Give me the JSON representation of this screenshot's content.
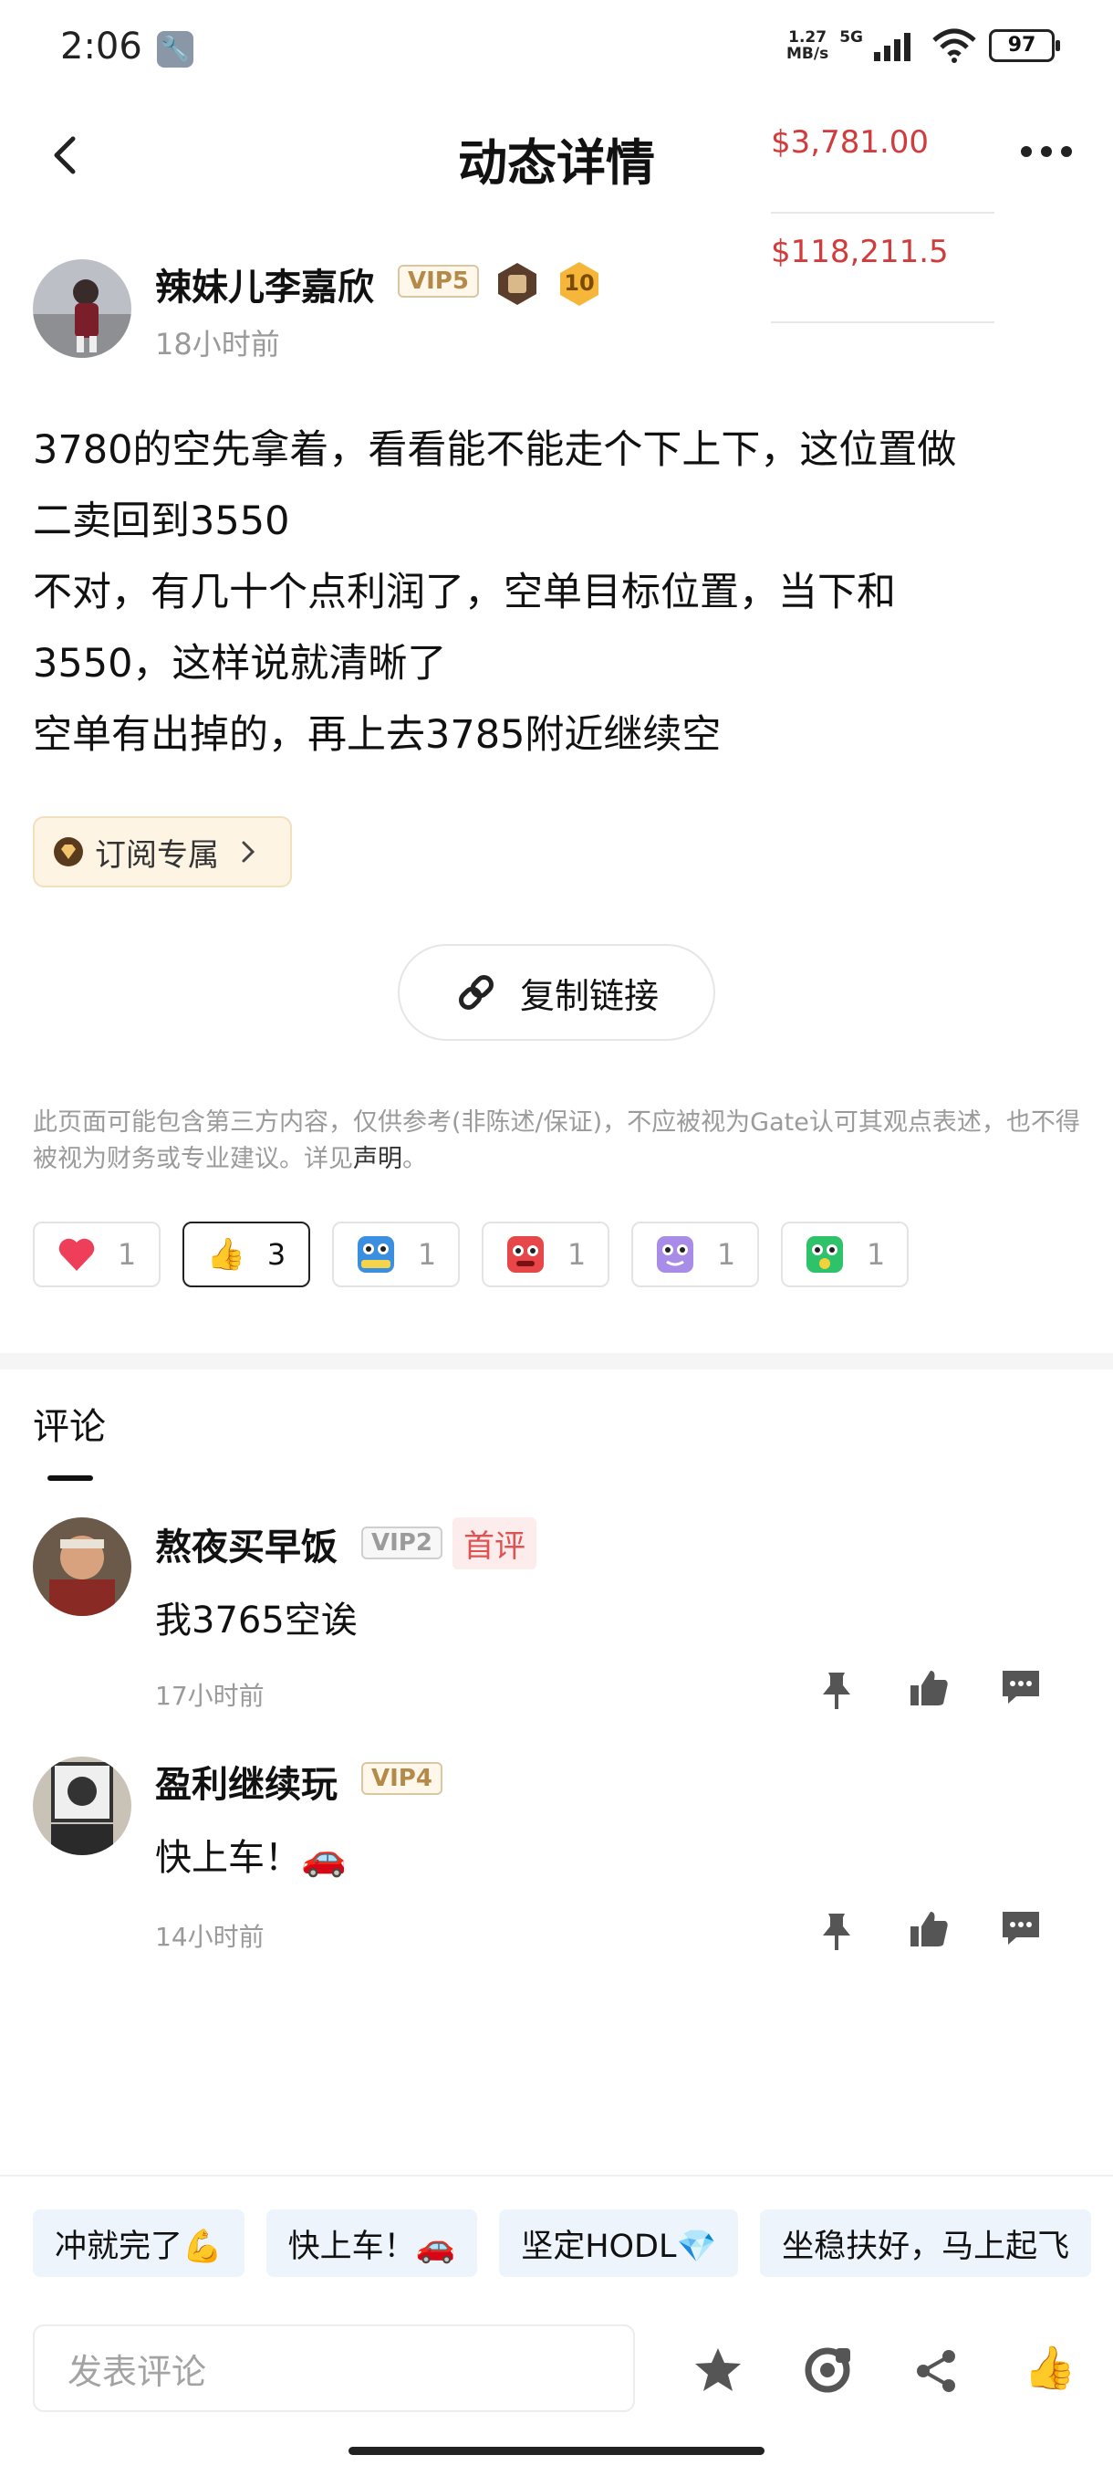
{
  "status_bar": {
    "time": "2:06",
    "net_speed_value": "1.27",
    "net_speed_unit": "MB/s",
    "network": "5G",
    "battery": "97"
  },
  "header": {
    "title": "动态详情",
    "back_icon": "chevron-left-icon",
    "more_icon": "more-horizontal-icon"
  },
  "tickers": [
    "$3,781.00",
    "$118,211.5"
  ],
  "author": {
    "name": "辣妹儿李嘉欣",
    "vip": "VIP5",
    "level": "10",
    "time": "18小时前"
  },
  "post": {
    "lines": [
      "3780的空先拿着，看看能不能走个下上下，这位置做",
      "二卖回到3550",
      "不对，有几十个点利润了，空单目标位置，当下和",
      "3550，这样说就清晰了",
      "空单有出掉的，再上去3785附近继续空"
    ]
  },
  "subscription_chip": {
    "label": "订阅专属"
  },
  "copy_link": {
    "label": "复制链接"
  },
  "disclaimer": {
    "text": "此页面可能包含第三方内容，仅供参考(非陈述/保证)，不应被视为Gate认可其观点表述，也不得被视为财务或专业建议。详见",
    "link": "声明",
    "end": "。"
  },
  "reactions": [
    {
      "icon": "heart-icon",
      "count": "1"
    },
    {
      "icon": "thumbs-up-icon",
      "count": "3"
    },
    {
      "icon": "hodl-icon",
      "count": "1"
    },
    {
      "icon": "angry-face-icon",
      "count": "1"
    },
    {
      "icon": "purple-face-icon",
      "count": "1"
    },
    {
      "icon": "green-face-icon",
      "count": "1"
    }
  ],
  "comments_section": {
    "title": "评论"
  },
  "comments": [
    {
      "name": "熬夜买早饭",
      "vip": "VIP2",
      "badge": "首评",
      "text": "我3765空诶",
      "time": "17小时前"
    },
    {
      "name": "盈利继续玩",
      "vip": "VIP4",
      "text": "快上车！🚗",
      "time": "14小时前"
    }
  ],
  "quick_replies": [
    "冲就完了💪",
    "快上车！🚗",
    "坚定HODL💎",
    "坐稳扶好，马上起飞"
  ],
  "comment_input": {
    "placeholder": "发表评论"
  },
  "colors": {
    "price": "#d23b3b",
    "vip_gold": "#b38a4a",
    "first_badge": "#e05252"
  }
}
